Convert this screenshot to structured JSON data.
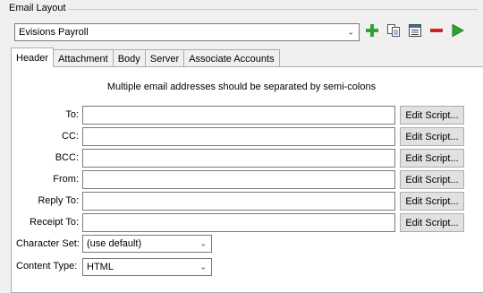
{
  "group": {
    "title": "Email Layout"
  },
  "layout_select": {
    "value": "Evisions Payroll"
  },
  "toolbar": [
    {
      "name": "add-icon"
    },
    {
      "name": "copy-icon"
    },
    {
      "name": "list-icon"
    },
    {
      "name": "remove-icon"
    },
    {
      "name": "run-icon"
    }
  ],
  "tabs": [
    "Header",
    "Attachment",
    "Body",
    "Server",
    "Associate Accounts"
  ],
  "active_tab": "Header",
  "note": "Multiple email addresses should be separated by semi-colons",
  "fields": [
    {
      "label": "To:",
      "value": "",
      "button": "Edit Script..."
    },
    {
      "label": "CC:",
      "value": "",
      "button": "Edit Script..."
    },
    {
      "label": "BCC:",
      "value": "",
      "button": "Edit Script..."
    },
    {
      "label": "From:",
      "value": "",
      "button": "Edit Script..."
    },
    {
      "label": "Reply To:",
      "value": "",
      "button": "Edit Script..."
    },
    {
      "label": "Receipt To:",
      "value": "",
      "button": "Edit Script..."
    }
  ],
  "character_set": {
    "label": "Character Set:",
    "value": "(use default)"
  },
  "content_type": {
    "label": "Content Type:",
    "value": "HTML"
  },
  "colors": {
    "add": "#2fa52f",
    "remove": "#d42020",
    "run": "#2fa52f"
  }
}
